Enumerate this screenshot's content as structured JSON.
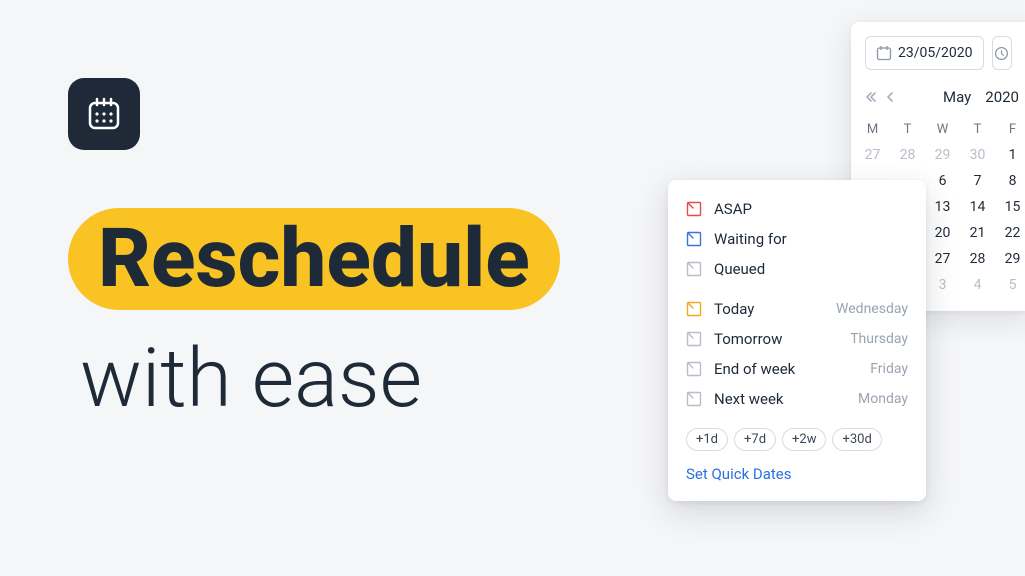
{
  "hero": {
    "title": "Reschedule",
    "subtitle": "with ease"
  },
  "datepicker": {
    "date_value": "23/05/2020",
    "month_label": "May",
    "year_label": "2020",
    "weekdays": [
      "M",
      "T",
      "W",
      "T",
      "F"
    ],
    "rows": [
      {
        "days": [
          "27",
          "28",
          "29",
          "30",
          "1"
        ],
        "muted": [
          true,
          true,
          true,
          true,
          false
        ]
      },
      {
        "days": [
          "6",
          "7",
          "8"
        ],
        "muted": [
          false,
          false,
          false
        ]
      },
      {
        "days": [
          "13",
          "14",
          "15"
        ],
        "muted": [
          false,
          false,
          false
        ]
      },
      {
        "days": [
          "20",
          "21",
          "22"
        ],
        "muted": [
          false,
          false,
          false
        ]
      },
      {
        "days": [
          "27",
          "28",
          "29"
        ],
        "muted": [
          false,
          false,
          false
        ]
      },
      {
        "days": [
          "3",
          "4",
          "5"
        ],
        "muted": [
          true,
          true,
          true
        ]
      }
    ]
  },
  "quick": {
    "groups": [
      [
        {
          "label": "ASAP",
          "sub": "",
          "icon": "red"
        },
        {
          "label": "Waiting for",
          "sub": "",
          "icon": "blue"
        },
        {
          "label": "Queued",
          "sub": "",
          "icon": "grey"
        }
      ],
      [
        {
          "label": "Today",
          "sub": "Wednesday",
          "icon": "orange"
        },
        {
          "label": "Tomorrow",
          "sub": "Thursday",
          "icon": "grey"
        },
        {
          "label": "End of week",
          "sub": "Friday",
          "icon": "grey"
        },
        {
          "label": "Next week",
          "sub": "Monday",
          "icon": "grey"
        }
      ]
    ],
    "chips": [
      "+1d",
      "+7d",
      "+2w",
      "+30d"
    ],
    "set_link": "Set Quick Dates"
  }
}
